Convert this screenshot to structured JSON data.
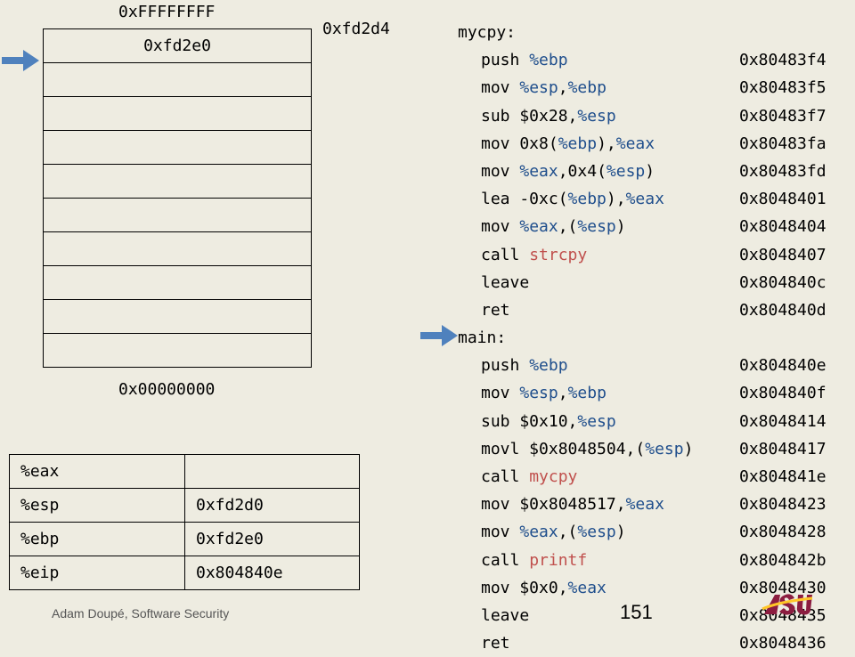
{
  "stack": {
    "top_address": "0xFFFFFFFF",
    "bottom_address": "0x00000000",
    "pointer_address": "0xfd2d4",
    "cells": [
      "0xfd2e0",
      "",
      "",
      "",
      "",
      "",
      "",
      "",
      "",
      ""
    ]
  },
  "registers": [
    {
      "name": "%eax",
      "value": ""
    },
    {
      "name": "%esp",
      "value": "0xfd2d0"
    },
    {
      "name": "%ebp",
      "value": "0xfd2e0"
    },
    {
      "name": "%eip",
      "value": "0x804840e"
    }
  ],
  "code": [
    {
      "type": "label",
      "text": "mycpy:"
    },
    {
      "type": "instr",
      "parts": [
        [
          "push ",
          "t"
        ],
        [
          "%ebp",
          "r"
        ]
      ],
      "addr": "0x80483f4"
    },
    {
      "type": "instr",
      "parts": [
        [
          "mov ",
          "t"
        ],
        [
          "%esp",
          "r"
        ],
        [
          ",",
          "t"
        ],
        [
          "%ebp",
          "r"
        ]
      ],
      "addr": "0x80483f5"
    },
    {
      "type": "instr",
      "parts": [
        [
          "sub $0x28,",
          "t"
        ],
        [
          "%esp",
          "r"
        ]
      ],
      "addr": "0x80483f7"
    },
    {
      "type": "instr",
      "parts": [
        [
          "mov 0x8(",
          "t"
        ],
        [
          "%ebp",
          "r"
        ],
        [
          "),",
          "t"
        ],
        [
          "%eax",
          "r"
        ]
      ],
      "addr": "0x80483fa"
    },
    {
      "type": "instr",
      "parts": [
        [
          "mov ",
          "t"
        ],
        [
          "%eax",
          "r"
        ],
        [
          ",0x4(",
          "t"
        ],
        [
          "%esp",
          "r"
        ],
        [
          ")",
          "t"
        ]
      ],
      "addr": "0x80483fd"
    },
    {
      "type": "instr",
      "parts": [
        [
          "lea -0xc(",
          "t"
        ],
        [
          "%ebp",
          "r"
        ],
        [
          "),",
          "t"
        ],
        [
          "%eax",
          "r"
        ]
      ],
      "addr": "0x8048401"
    },
    {
      "type": "instr",
      "parts": [
        [
          "mov ",
          "t"
        ],
        [
          "%eax",
          "r"
        ],
        [
          ",(",
          "t"
        ],
        [
          "%esp",
          "r"
        ],
        [
          ")",
          "t"
        ]
      ],
      "addr": "0x8048404"
    },
    {
      "type": "instr",
      "parts": [
        [
          "call ",
          "t"
        ],
        [
          "strcpy",
          "s"
        ]
      ],
      "addr": "0x8048407"
    },
    {
      "type": "instr",
      "parts": [
        [
          "leave",
          "t"
        ]
      ],
      "addr": "0x804840c"
    },
    {
      "type": "instr",
      "parts": [
        [
          "ret",
          "t"
        ]
      ],
      "addr": "0x804840d"
    },
    {
      "type": "label",
      "text": "main:"
    },
    {
      "type": "instr",
      "parts": [
        [
          "push ",
          "t"
        ],
        [
          "%ebp",
          "r"
        ]
      ],
      "addr": "0x804840e"
    },
    {
      "type": "instr",
      "parts": [
        [
          "mov ",
          "t"
        ],
        [
          "%esp",
          "r"
        ],
        [
          ",",
          "t"
        ],
        [
          "%ebp",
          "r"
        ]
      ],
      "addr": "0x804840f"
    },
    {
      "type": "instr",
      "parts": [
        [
          "sub $0x10,",
          "t"
        ],
        [
          "%esp",
          "r"
        ]
      ],
      "addr": "0x8048414"
    },
    {
      "type": "instr",
      "parts": [
        [
          "movl $0x8048504,(",
          "t"
        ],
        [
          "%esp",
          "r"
        ],
        [
          ")",
          "t"
        ]
      ],
      "addr": "0x8048417"
    },
    {
      "type": "instr",
      "parts": [
        [
          "call ",
          "t"
        ],
        [
          "mycpy",
          "s"
        ]
      ],
      "addr": "0x804841e"
    },
    {
      "type": "instr",
      "parts": [
        [
          "mov $0x8048517,",
          "t"
        ],
        [
          "%eax",
          "r"
        ]
      ],
      "addr": "0x8048423"
    },
    {
      "type": "instr",
      "parts": [
        [
          "mov ",
          "t"
        ],
        [
          "%eax",
          "r"
        ],
        [
          ",(",
          "t"
        ],
        [
          "%esp",
          "r"
        ],
        [
          ")",
          "t"
        ]
      ],
      "addr": "0x8048428"
    },
    {
      "type": "instr",
      "parts": [
        [
          "call ",
          "t"
        ],
        [
          "printf",
          "s"
        ]
      ],
      "addr": "0x804842b"
    },
    {
      "type": "instr",
      "parts": [
        [
          "mov $0x0,",
          "t"
        ],
        [
          "%eax",
          "r"
        ]
      ],
      "addr": "0x8048430"
    },
    {
      "type": "instr",
      "parts": [
        [
          "leave",
          "t"
        ]
      ],
      "addr": "0x8048435"
    },
    {
      "type": "instr",
      "parts": [
        [
          "ret",
          "t"
        ]
      ],
      "addr": "0x8048436"
    }
  ],
  "pointers": {
    "esp_row": 1,
    "eip_line": 12
  },
  "colors": {
    "register": "#1f4e8c",
    "symbol": "#c0504d",
    "arrow": "#4f81bd",
    "background": "#eeece1"
  },
  "icons": {
    "esp_arrow": "right-arrow-icon",
    "eip_arrow": "right-arrow-icon",
    "logo": "asu-logo"
  },
  "footer": {
    "author": "Adam Doupé, Software Security",
    "page": "151",
    "logo_text": "ASU"
  }
}
